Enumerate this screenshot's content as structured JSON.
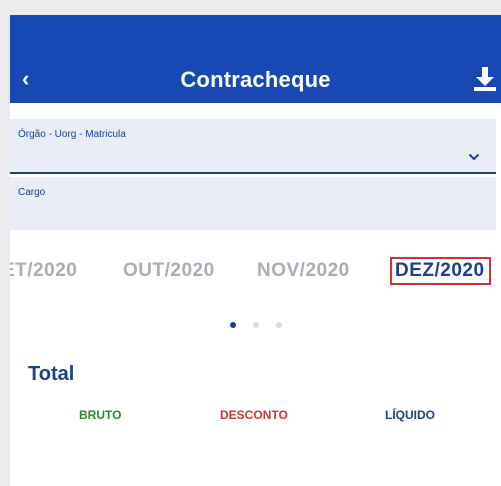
{
  "header": {
    "title": "Contracheque",
    "back_icon": "chevron-left-icon",
    "download_icon": "download-icon"
  },
  "form": {
    "field1_label": "Órgão - Uorg - Matricula",
    "field2_label": "Cargo",
    "dropdown_icon": "chevron-down-icon"
  },
  "months": {
    "items": [
      "ET/2020",
      "OUT/2020",
      "NOV/2020",
      "DEZ/2020"
    ],
    "selected_index": 3
  },
  "pager": {
    "count": 3,
    "active_index": 0
  },
  "summary": {
    "title": "Total",
    "bruto_label": "BRUTO",
    "desconto_label": "DESCONTO",
    "liquido_label": "LÍQUIDO"
  },
  "colors": {
    "primary": "#1848b4",
    "field_bg": "#e9edf6",
    "bruto": "#2b8a2b",
    "desconto": "#d23232",
    "liquido": "#1c3f8f",
    "selected_border": "#cf3434"
  }
}
